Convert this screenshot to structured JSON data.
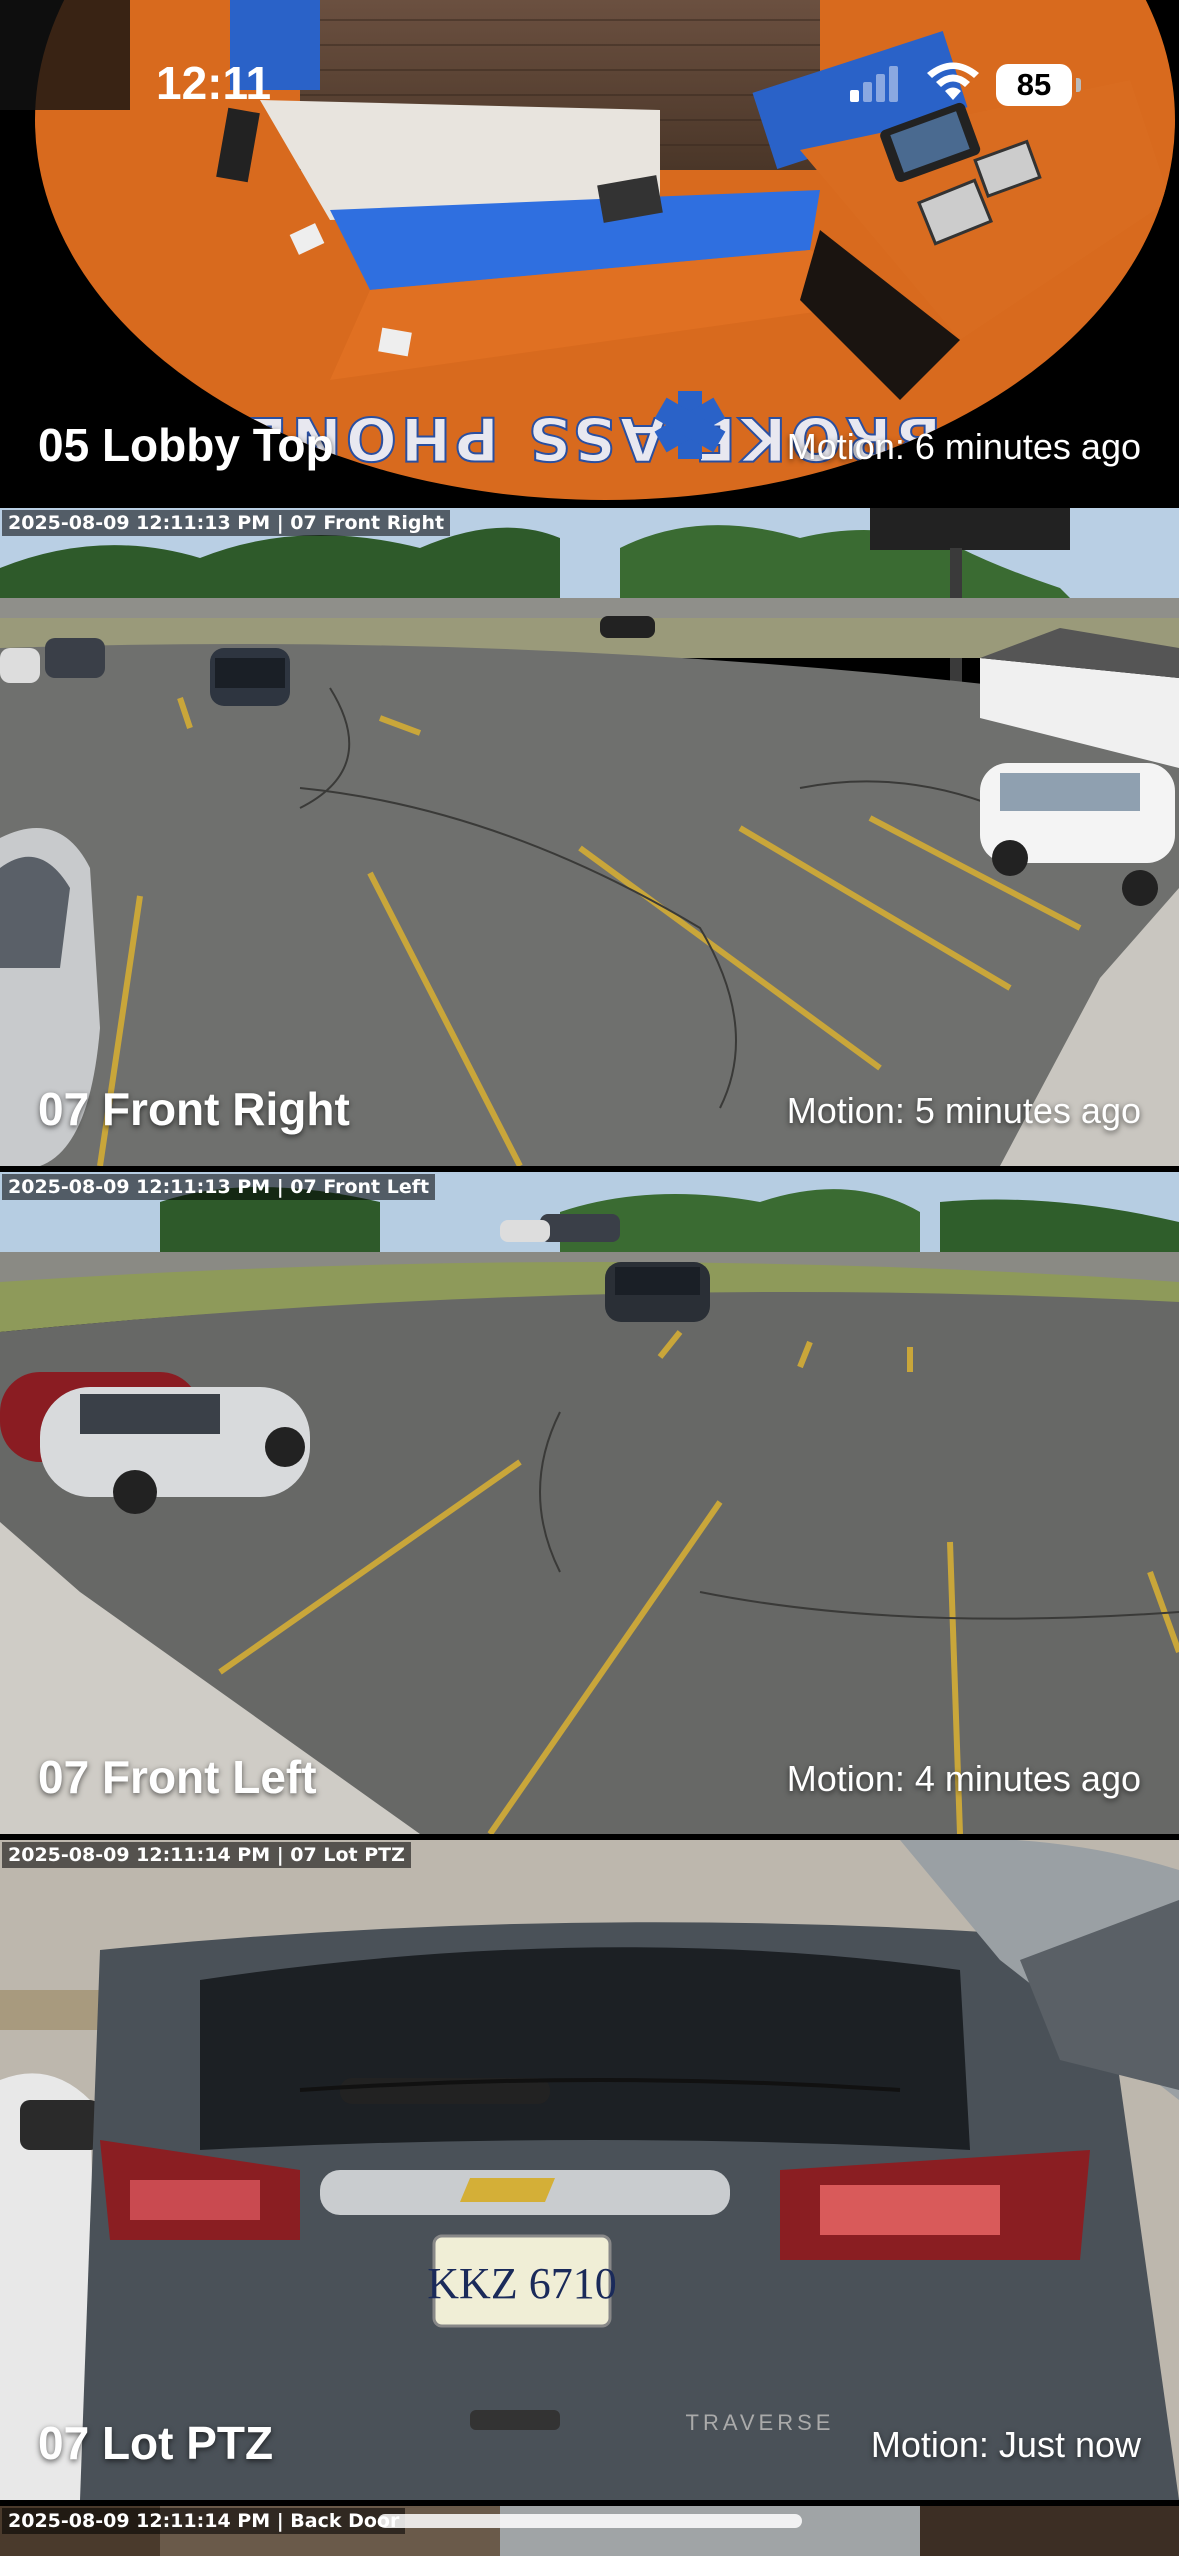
{
  "status_bar": {
    "time": "12:11",
    "battery": "85"
  },
  "feeds": [
    {
      "name": "05 Lobby Top",
      "motion": "Motion: 6 minutes ago",
      "overlay": "",
      "sign_text": "BROKE ASS PHONE"
    },
    {
      "name": "07 Front Right",
      "motion": "Motion: 5 minutes ago",
      "overlay": "2025-08-09 12:11:13 PM | 07 Front Right"
    },
    {
      "name": "07 Front Left",
      "motion": "Motion: 4 minutes ago",
      "overlay": "2025-08-09 12:11:13 PM | 07 Front Left"
    },
    {
      "name": "07 Lot PTZ",
      "motion": "Motion: Just now",
      "overlay": "2025-08-09 12:11:14 PM | 07 Lot PTZ",
      "plate": "KKZ 6710",
      "badge": "TRAVERSE"
    },
    {
      "name": "Back Door",
      "overlay": "2025-08-09 12:11:14 PM | Back Door"
    }
  ]
}
